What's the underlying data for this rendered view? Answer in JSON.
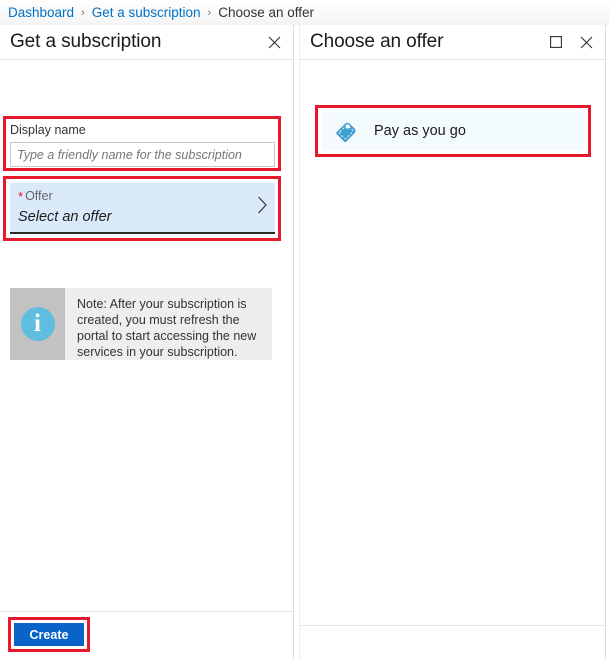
{
  "breadcrumb": {
    "items": [
      {
        "label": "Dashboard",
        "current": false
      },
      {
        "label": "Get a subscription",
        "current": false
      },
      {
        "label": "Choose an offer",
        "current": true
      }
    ],
    "separator": "›"
  },
  "left_blade": {
    "title": "Get a subscription",
    "close_label": "Close",
    "display_name": {
      "label": "Display name",
      "value": "",
      "placeholder": "Type a friendly name for the subscription"
    },
    "offer": {
      "required_marker": "*",
      "label": "Offer",
      "value": "Select an offer"
    },
    "note": {
      "text": "Note: After your subscription is created, you must refresh the portal to start accessing the new services in your subscription.",
      "icon_glyph": "i"
    },
    "create_button": "Create"
  },
  "right_blade": {
    "title": "Choose an offer",
    "maximize_label": "Maximize",
    "close_label": "Close",
    "offers": [
      {
        "label": "Pay as you go"
      }
    ]
  },
  "colors": {
    "breadcrumb_link": "#0072c6",
    "highlight_red": "#e8192c",
    "primary_button": "#0a63c9",
    "offer_field_bg": "#dbeafb",
    "offer_row_bg": "#f3fbfe",
    "tag_icon": "#3f9fd0",
    "info_icon": "#5fbde0",
    "note_bg": "#eeeeee",
    "note_icon_bg": "#c2c2c2"
  }
}
